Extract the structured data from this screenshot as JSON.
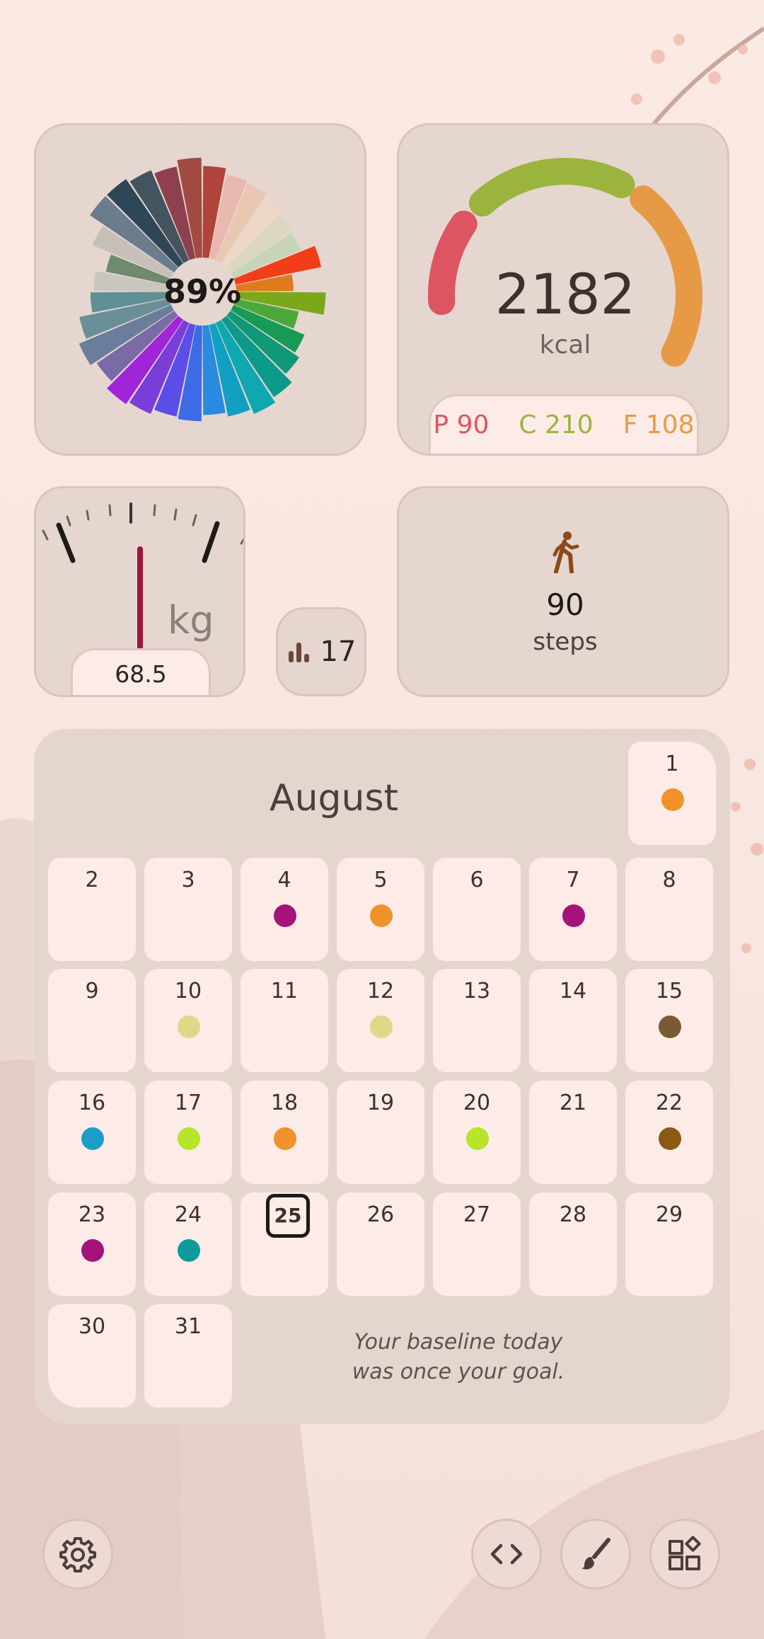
{
  "ring_widget": {
    "percent": "89%",
    "segments": [
      {
        "color": "#b0443a",
        "level": 0.88
      },
      {
        "color": "#e9b8ae",
        "level": 0.82
      },
      {
        "color": "#e8c8b0",
        "level": 0.8
      },
      {
        "color": "#f0d8c8",
        "level": 0.76
      },
      {
        "color": "#dcd8c0",
        "level": 0.72
      },
      {
        "color": "#c8d4b8",
        "level": 0.7
      },
      {
        "color": "#f13d18",
        "level": 0.84
      },
      {
        "color": "#e07a1a",
        "level": 0.55
      },
      {
        "color": "#7aa81a",
        "level": 0.86
      },
      {
        "color": "#4ca83a",
        "level": 0.62
      },
      {
        "color": "#169a55",
        "level": 0.74
      },
      {
        "color": "#119876",
        "level": 0.8
      },
      {
        "color": "#0d9a8a",
        "level": 0.9
      },
      {
        "color": "#0fa7b0",
        "level": 0.95
      },
      {
        "color": "#12a0c2",
        "level": 0.9
      },
      {
        "color": "#2a8ae0",
        "level": 0.86
      },
      {
        "color": "#3d6be8",
        "level": 0.92
      },
      {
        "color": "#5a4de8",
        "level": 0.9
      },
      {
        "color": "#7a3ed8",
        "level": 0.95
      },
      {
        "color": "#a024d8",
        "level": 0.98
      },
      {
        "color": "#7a6aa6",
        "level": 0.9
      },
      {
        "color": "#6a7d9a",
        "level": 0.96
      },
      {
        "color": "#6a8f96",
        "level": 0.88
      },
      {
        "color": "#5f9096",
        "level": 0.75
      },
      {
        "color": "#c9c7bd",
        "level": 0.72
      },
      {
        "color": "#6f8a6f",
        "level": 0.62
      },
      {
        "color": "#c7c0b8",
        "level": 0.82
      },
      {
        "color": "#6b7c8c",
        "level": 0.98
      },
      {
        "color": "#2f4656",
        "level": 0.98
      },
      {
        "color": "#43545e",
        "level": 0.94
      },
      {
        "color": "#8f4050",
        "level": 0.9
      },
      {
        "color": "#a04a42",
        "level": 0.96
      }
    ]
  },
  "calorie_widget": {
    "value": "2182",
    "unit": "kcal",
    "protein": "P 90",
    "carbs": "C 210",
    "fat": "F 108",
    "colors": {
      "protein": "#dd5560",
      "carbs": "#9bb43e",
      "fat": "#e79a45"
    },
    "arcs": {
      "protein": 0.35,
      "carbs": 0.85,
      "fat": 0.62
    }
  },
  "weight_widget": {
    "value": "68.5",
    "unit": "kg",
    "needle_color": "#a0143a"
  },
  "sessions_pill": {
    "icon": "bar-chart-icon",
    "value": "17"
  },
  "steps_widget": {
    "icon": "walking-icon",
    "value": "90",
    "label": "steps",
    "icon_color": "#8a4a1a"
  },
  "calendar": {
    "month": "August",
    "today": 25,
    "days": [
      {
        "day": "1",
        "dot": "#f0922a"
      },
      {
        "day": "2",
        "dot": null
      },
      {
        "day": "3",
        "dot": null
      },
      {
        "day": "4",
        "dot": "#a3137a"
      },
      {
        "day": "5",
        "dot": "#f0922a"
      },
      {
        "day": "6",
        "dot": null
      },
      {
        "day": "7",
        "dot": "#a3137a"
      },
      {
        "day": "8",
        "dot": null
      },
      {
        "day": "9",
        "dot": null
      },
      {
        "day": "10",
        "dot": "#dcd98a"
      },
      {
        "day": "11",
        "dot": null
      },
      {
        "day": "12",
        "dot": "#dcd98a"
      },
      {
        "day": "13",
        "dot": null
      },
      {
        "day": "14",
        "dot": null
      },
      {
        "day": "15",
        "dot": "#7a5a34"
      },
      {
        "day": "16",
        "dot": "#1a9ec8"
      },
      {
        "day": "17",
        "dot": "#b6e52a"
      },
      {
        "day": "18",
        "dot": "#f0922a"
      },
      {
        "day": "19",
        "dot": null
      },
      {
        "day": "20",
        "dot": "#b6e52a"
      },
      {
        "day": "21",
        "dot": null
      },
      {
        "day": "22",
        "dot": "#8a5a14"
      },
      {
        "day": "23",
        "dot": "#a3137a"
      },
      {
        "day": "24",
        "dot": "#0f9a9a"
      },
      {
        "day": "25",
        "dot": null
      },
      {
        "day": "26",
        "dot": null
      },
      {
        "day": "27",
        "dot": null
      },
      {
        "day": "28",
        "dot": null
      },
      {
        "day": "29",
        "dot": null
      },
      {
        "day": "30",
        "dot": null
      },
      {
        "day": "31",
        "dot": null
      }
    ],
    "quote_line1": "Your baseline today",
    "quote_line2": "was once your goal."
  },
  "bottom_bar": {
    "settings_icon": "gear-icon",
    "code_icon": "code-icon",
    "brush_icon": "brush-icon",
    "widgets_icon": "widgets-icon"
  }
}
